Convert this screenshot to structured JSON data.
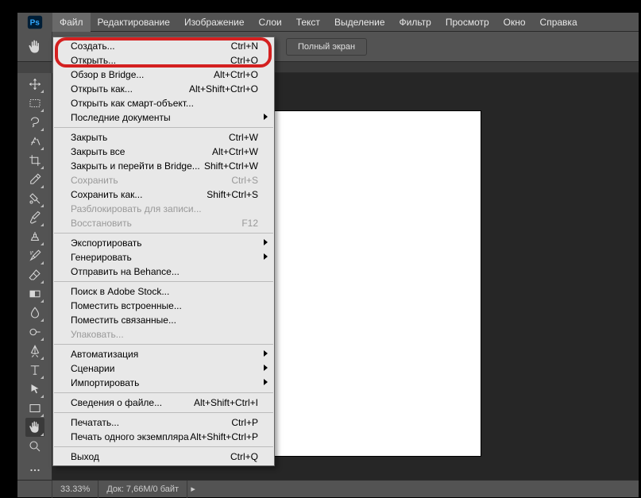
{
  "menubar": {
    "items": [
      "Файл",
      "Редактирование",
      "Изображение",
      "Слои",
      "Текст",
      "Выделение",
      "Фильтр",
      "Просмотр",
      "Окно",
      "Справка"
    ]
  },
  "options": {
    "full_screen": "Полный экран"
  },
  "file_menu": {
    "groups": [
      [
        {
          "label": "Создать...",
          "shortcut": "Ctrl+N",
          "disabled": false
        },
        {
          "label": "Открыть...",
          "shortcut": "Ctrl+O",
          "disabled": false
        },
        {
          "label": "Обзор в Bridge...",
          "shortcut": "Alt+Ctrl+O",
          "disabled": false
        },
        {
          "label": "Открыть как...",
          "shortcut": "Alt+Shift+Ctrl+O",
          "disabled": false
        },
        {
          "label": "Открыть как смарт-объект...",
          "shortcut": "",
          "disabled": false
        },
        {
          "label": "Последние документы",
          "shortcut": "",
          "disabled": false,
          "submenu": true
        }
      ],
      [
        {
          "label": "Закрыть",
          "shortcut": "Ctrl+W",
          "disabled": false
        },
        {
          "label": "Закрыть все",
          "shortcut": "Alt+Ctrl+W",
          "disabled": false
        },
        {
          "label": "Закрыть и перейти в Bridge...",
          "shortcut": "Shift+Ctrl+W",
          "disabled": false
        },
        {
          "label": "Сохранить",
          "shortcut": "Ctrl+S",
          "disabled": true
        },
        {
          "label": "Сохранить как...",
          "shortcut": "Shift+Ctrl+S",
          "disabled": false
        },
        {
          "label": "Разблокировать для записи...",
          "shortcut": "",
          "disabled": true
        },
        {
          "label": "Восстановить",
          "shortcut": "F12",
          "disabled": true
        }
      ],
      [
        {
          "label": "Экспортировать",
          "shortcut": "",
          "disabled": false,
          "submenu": true
        },
        {
          "label": "Генерировать",
          "shortcut": "",
          "disabled": false,
          "submenu": true
        },
        {
          "label": "Отправить на Behance...",
          "shortcut": "",
          "disabled": false
        }
      ],
      [
        {
          "label": "Поиск в Adobe Stock...",
          "shortcut": "",
          "disabled": false
        },
        {
          "label": "Поместить встроенные...",
          "shortcut": "",
          "disabled": false
        },
        {
          "label": "Поместить связанные...",
          "shortcut": "",
          "disabled": false
        },
        {
          "label": "Упаковать...",
          "shortcut": "",
          "disabled": true
        }
      ],
      [
        {
          "label": "Автоматизация",
          "shortcut": "",
          "disabled": false,
          "submenu": true
        },
        {
          "label": "Сценарии",
          "shortcut": "",
          "disabled": false,
          "submenu": true
        },
        {
          "label": "Импортировать",
          "shortcut": "",
          "disabled": false,
          "submenu": true
        }
      ],
      [
        {
          "label": "Сведения о файле...",
          "shortcut": "Alt+Shift+Ctrl+I",
          "disabled": false
        }
      ],
      [
        {
          "label": "Печатать...",
          "shortcut": "Ctrl+P",
          "disabled": false
        },
        {
          "label": "Печать одного экземпляра",
          "shortcut": "Alt+Shift+Ctrl+P",
          "disabled": false
        }
      ],
      [
        {
          "label": "Выход",
          "shortcut": "Ctrl+Q",
          "disabled": false
        }
      ]
    ]
  },
  "tools": [
    "move-tool",
    "marquee-tool",
    "lasso-tool",
    "quick-select-tool",
    "crop-tool",
    "eyedropper-tool",
    "spot-heal-tool",
    "brush-tool",
    "clone-stamp-tool",
    "history-brush-tool",
    "eraser-tool",
    "gradient-tool",
    "blur-tool",
    "dodge-tool",
    "pen-tool",
    "type-tool",
    "path-select-tool",
    "rectangle-tool",
    "hand-tool",
    "zoom-tool"
  ],
  "status": {
    "zoom": "33.33%",
    "doc": "Док: 7,66M/0 байт"
  }
}
